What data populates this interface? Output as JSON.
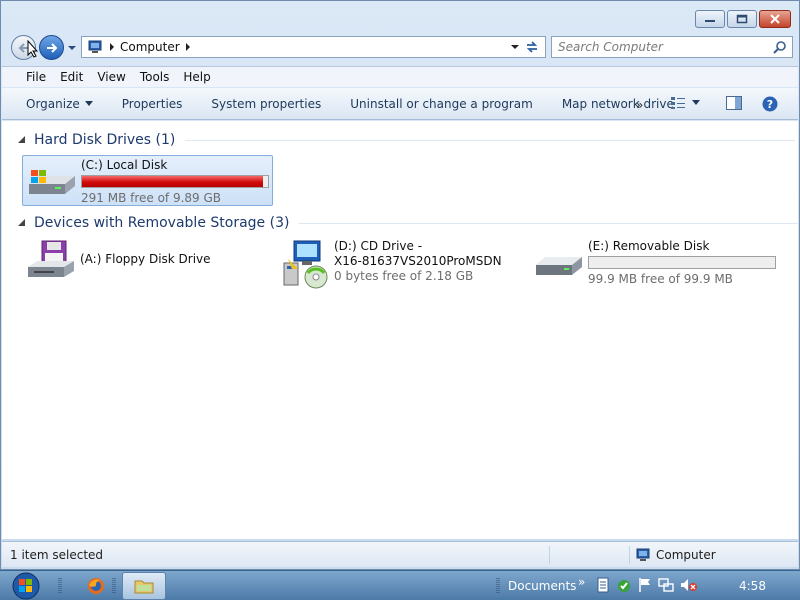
{
  "window": {
    "caption_buttons": [
      "minimize-icon",
      "maximize-icon",
      "close-icon"
    ]
  },
  "nav": {
    "address": {
      "icon": "computer-icon",
      "crumbs": [
        "Computer"
      ]
    },
    "search_placeholder": "Search Computer"
  },
  "menu": [
    "File",
    "Edit",
    "View",
    "Tools",
    "Help"
  ],
  "commands": {
    "organize": "Organize",
    "properties": "Properties",
    "system_properties": "System properties",
    "uninstall": "Uninstall or change a program",
    "map_drive": "Map network drive",
    "more": "»"
  },
  "groups": {
    "hdd": {
      "title": "Hard Disk Drives (1)",
      "drives": [
        {
          "name": "(C:) Local Disk",
          "free": "291 MB free of 9.89 GB",
          "used_fraction": 0.971
        }
      ]
    },
    "removable": {
      "title": "Devices with Removable Storage (3)",
      "floppy": {
        "name": "(A:) Floppy Disk Drive"
      },
      "cd": {
        "name_line1": "(D:) CD Drive -",
        "name_line2": "X16-81637VS2010ProMSDN",
        "free": "0 bytes free of 2.18 GB"
      },
      "usb": {
        "name": "(E:) Removable Disk",
        "free": "99.9 MB free of 99.9 MB",
        "used_fraction": 0.0
      }
    }
  },
  "status": {
    "left": "1 item selected",
    "right": "Computer"
  },
  "taskbar": {
    "documents": "Documents",
    "chevron": "»",
    "clock": "4:58"
  },
  "colors": {
    "accent": "#1e3a6e",
    "bar_full": "#d20b0b"
  }
}
